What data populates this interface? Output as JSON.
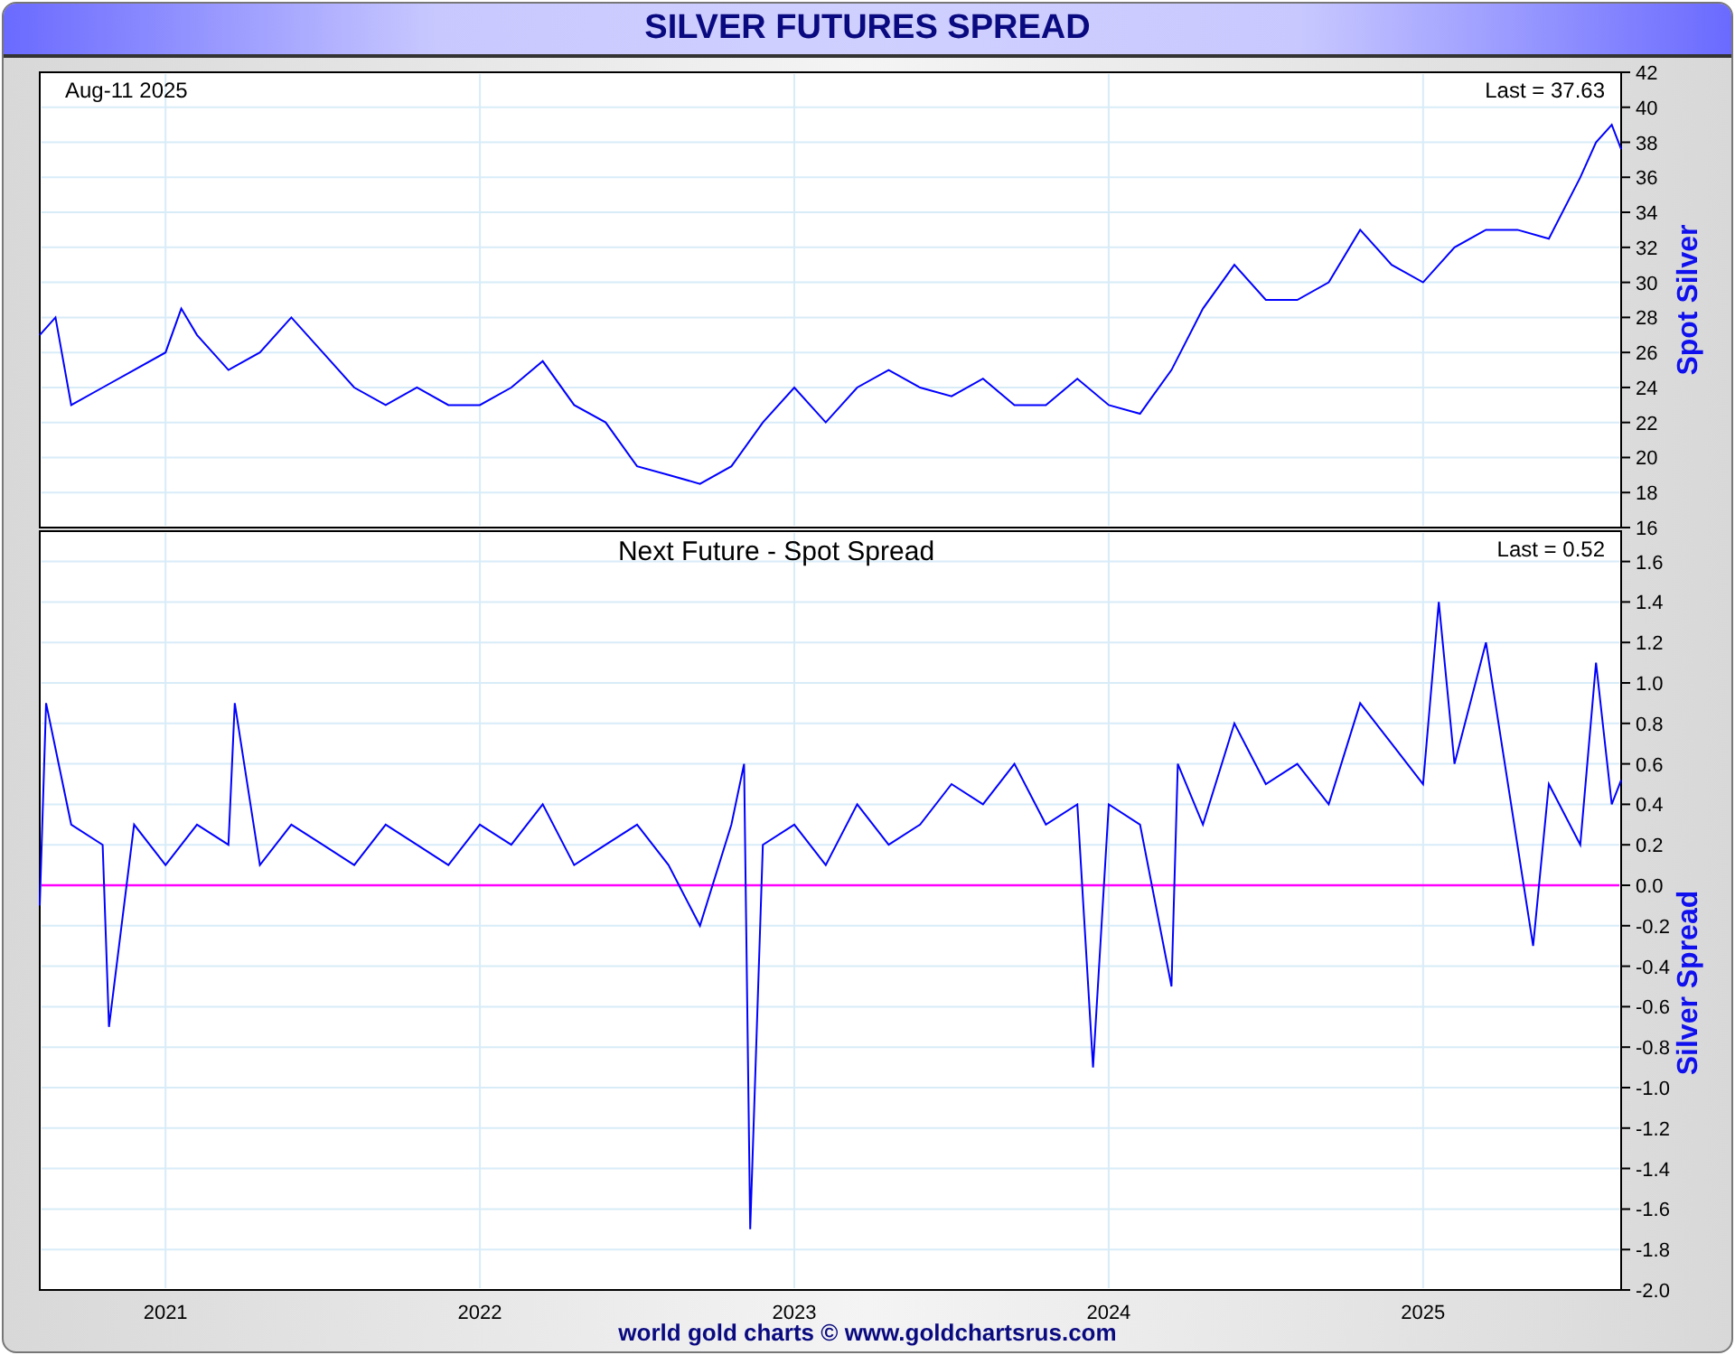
{
  "window": {
    "title": "SILVER FUTURES SPREAD"
  },
  "panels": [
    {
      "date_label": "Aug-11  2025",
      "last_label": "Last = 37.63",
      "chart_data": {
        "type": "line",
        "ylabel": "Spot Silver",
        "xlim": [
          2020.6,
          2025.63
        ],
        "ylim": [
          16,
          42
        ],
        "x": [
          2020.6,
          2020.65,
          2020.7,
          2020.8,
          2020.9,
          2021.0,
          2021.05,
          2021.1,
          2021.2,
          2021.3,
          2021.4,
          2021.5,
          2021.6,
          2021.7,
          2021.8,
          2021.9,
          2022.0,
          2022.1,
          2022.2,
          2022.3,
          2022.4,
          2022.5,
          2022.6,
          2022.7,
          2022.8,
          2022.9,
          2023.0,
          2023.1,
          2023.2,
          2023.3,
          2023.4,
          2023.5,
          2023.6,
          2023.7,
          2023.8,
          2023.9,
          2024.0,
          2024.1,
          2024.2,
          2024.3,
          2024.4,
          2024.5,
          2024.6,
          2024.7,
          2024.8,
          2024.9,
          2025.0,
          2025.1,
          2025.2,
          2025.3,
          2025.4,
          2025.5,
          2025.55,
          2025.6,
          2025.63
        ],
        "series": [
          {
            "color": "#0000ff",
            "values": [
              27,
              28,
              23,
              24,
              25,
              26,
              28.5,
              27,
              25,
              26,
              28,
              26,
              24,
              23,
              24,
              23,
              23,
              24,
              25.5,
              23,
              22,
              19.5,
              19,
              18.5,
              19.5,
              22,
              24,
              22,
              24,
              25,
              24,
              23.5,
              24.5,
              23,
              23,
              24.5,
              23,
              22.5,
              25,
              28.5,
              31,
              29,
              29,
              30,
              33,
              31,
              30,
              32,
              33,
              33,
              32.5,
              36,
              38,
              39,
              37.6
            ]
          }
        ],
        "grid": true,
        "yticks": [
          16,
          18,
          20,
          22,
          24,
          26,
          28,
          30,
          32,
          34,
          36,
          38,
          40,
          42
        ]
      }
    },
    {
      "last_label": "Last = 0.52",
      "chart_data": {
        "type": "line",
        "title": "Next Future - Spot Spread",
        "ylabel": "Silver Spread",
        "xlim": [
          2020.6,
          2025.63
        ],
        "ylim": [
          -2.0,
          1.75
        ],
        "x": [
          2020.6,
          2020.62,
          2020.7,
          2020.8,
          2020.82,
          2020.9,
          2021.0,
          2021.1,
          2021.2,
          2021.22,
          2021.3,
          2021.4,
          2021.5,
          2021.6,
          2021.7,
          2021.8,
          2021.9,
          2022.0,
          2022.1,
          2022.2,
          2022.3,
          2022.4,
          2022.5,
          2022.6,
          2022.7,
          2022.8,
          2022.84,
          2022.86,
          2022.9,
          2023.0,
          2023.1,
          2023.2,
          2023.3,
          2023.4,
          2023.5,
          2023.6,
          2023.7,
          2023.8,
          2023.9,
          2023.95,
          2024.0,
          2024.1,
          2024.2,
          2024.22,
          2024.3,
          2024.4,
          2024.5,
          2024.6,
          2024.7,
          2024.8,
          2024.9,
          2025.0,
          2025.05,
          2025.1,
          2025.2,
          2025.3,
          2025.35,
          2025.4,
          2025.5,
          2025.55,
          2025.6,
          2025.63
        ],
        "series": [
          {
            "color": "#0000ff",
            "values": [
              -0.1,
              0.9,
              0.3,
              0.2,
              -0.7,
              0.3,
              0.1,
              0.3,
              0.2,
              0.9,
              0.1,
              0.3,
              0.2,
              0.1,
              0.3,
              0.2,
              0.1,
              0.3,
              0.2,
              0.4,
              0.1,
              0.2,
              0.3,
              0.1,
              -0.2,
              0.3,
              0.6,
              -1.7,
              0.2,
              0.3,
              0.1,
              0.4,
              0.2,
              0.3,
              0.5,
              0.4,
              0.6,
              0.3,
              0.4,
              -0.9,
              0.4,
              0.3,
              -0.5,
              0.6,
              0.3,
              0.8,
              0.5,
              0.6,
              0.4,
              0.9,
              0.7,
              0.5,
              1.4,
              0.6,
              1.2,
              0.2,
              -0.3,
              0.5,
              0.2,
              1.1,
              0.4,
              0.52
            ]
          }
        ],
        "grid": true,
        "yticks": [
          {
            "value": -2.0,
            "label": "-2.0"
          },
          {
            "value": -1.8,
            "label": "-1.8"
          },
          {
            "value": -1.6,
            "label": "-1.6"
          },
          {
            "value": -1.4,
            "label": "-1.4"
          },
          {
            "value": -1.2,
            "label": "-1.2"
          },
          {
            "value": -1.0,
            "label": "-1.0"
          },
          {
            "value": -0.8,
            "label": "-0.8"
          },
          {
            "value": -0.6,
            "label": "-0.6"
          },
          {
            "value": -0.4,
            "label": "-0.4"
          },
          {
            "value": -0.2,
            "label": "-0.2"
          },
          {
            "value": 0,
            "label": "0.0"
          },
          {
            "value": 0.2,
            "label": "0.2"
          },
          {
            "value": 0.4,
            "label": "0.4"
          },
          {
            "value": 0.6,
            "label": "0.6"
          },
          {
            "value": 0.8,
            "label": "0.8"
          },
          {
            "value": 1.0,
            "label": "1.0"
          },
          {
            "value": 1.2,
            "label": "1.2"
          },
          {
            "value": 1.4,
            "label": "1.4"
          },
          {
            "value": 1.6,
            "label": "1.6"
          }
        ],
        "xticks": [
          {
            "value": 2021,
            "label": "2021"
          },
          {
            "value": 2022,
            "label": "2022"
          },
          {
            "value": 2023,
            "label": "2023"
          },
          {
            "value": 2024,
            "label": "2024"
          },
          {
            "value": 2025,
            "label": "2025"
          }
        ],
        "ref_lines": [
          {
            "axis": "y",
            "value": 0
          }
        ]
      }
    }
  ],
  "footer": "world gold charts © www.goldchartsrus.com"
}
